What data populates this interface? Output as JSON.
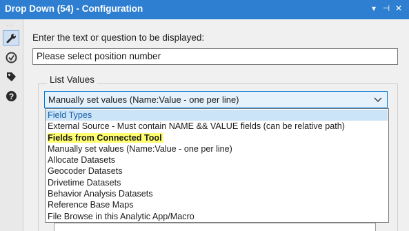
{
  "window": {
    "title": "Drop Down (54) - Configuration",
    "controls": {
      "menu": "▾",
      "pin": "⊣",
      "close": "✕"
    }
  },
  "rail": {
    "dots": "...",
    "icons": [
      "wrench-icon",
      "connection-icon",
      "tag-icon",
      "help-icon"
    ]
  },
  "config": {
    "prompt_label": "Enter the text or question to be displayed:",
    "prompt_value": "Please select position number",
    "list_values_label": "List Values",
    "selected_value": "Manually set values (Name:Value - one per line)"
  },
  "dropdown": {
    "options": [
      "Field Types",
      "External Source - Must contain NAME && VALUE fields  (can be relative path)",
      "Fields from Connected Tool",
      "Manually set values (Name:Value - one per line)",
      "Allocate Datasets",
      "Geocoder Datasets",
      "Drivetime Datasets",
      "Behavior Analysis Datasets",
      "Reference Base Maps",
      "File Browse in this Analytic App/Macro"
    ],
    "hovered_index": 0,
    "highlighted_index": 2
  },
  "colors": {
    "titlebar": "#2e7fd1",
    "accent": "#0078d7",
    "highlight": "#ffff70"
  }
}
